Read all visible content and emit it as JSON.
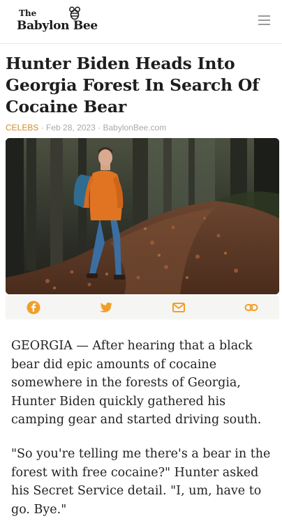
{
  "header": {
    "logo_small": "The",
    "logo_name": "Babylon Bee",
    "logo_icon": "bee-icon",
    "menu_icon": "hamburger-menu-icon"
  },
  "article": {
    "title": "Hunter Biden Heads Into Georgia Forest In Search Of Cocaine Bear",
    "category": "CELEBS",
    "separator": "·",
    "date": "Feb 28, 2023",
    "source": "BabylonBee.com",
    "paragraphs": [
      "GEORGIA — After hearing that a black bear did epic amounts of cocaine somewhere in the forests of Georgia, Hunter Biden quickly gathered his camping gear and started driving south.",
      "\"So you're telling me there's a bear in the forest with free cocaine?\" Hunter asked his Secret Service detail. \"I, um, have to go. Bye.\""
    ]
  },
  "share": {
    "icons": [
      "facebook-icon",
      "twitter-icon",
      "email-icon",
      "link-icon"
    ]
  },
  "colors": {
    "accent": "#f0a02a",
    "category": "#d38a2b",
    "meta": "#a9a9a9",
    "title": "#1e1e1e"
  }
}
